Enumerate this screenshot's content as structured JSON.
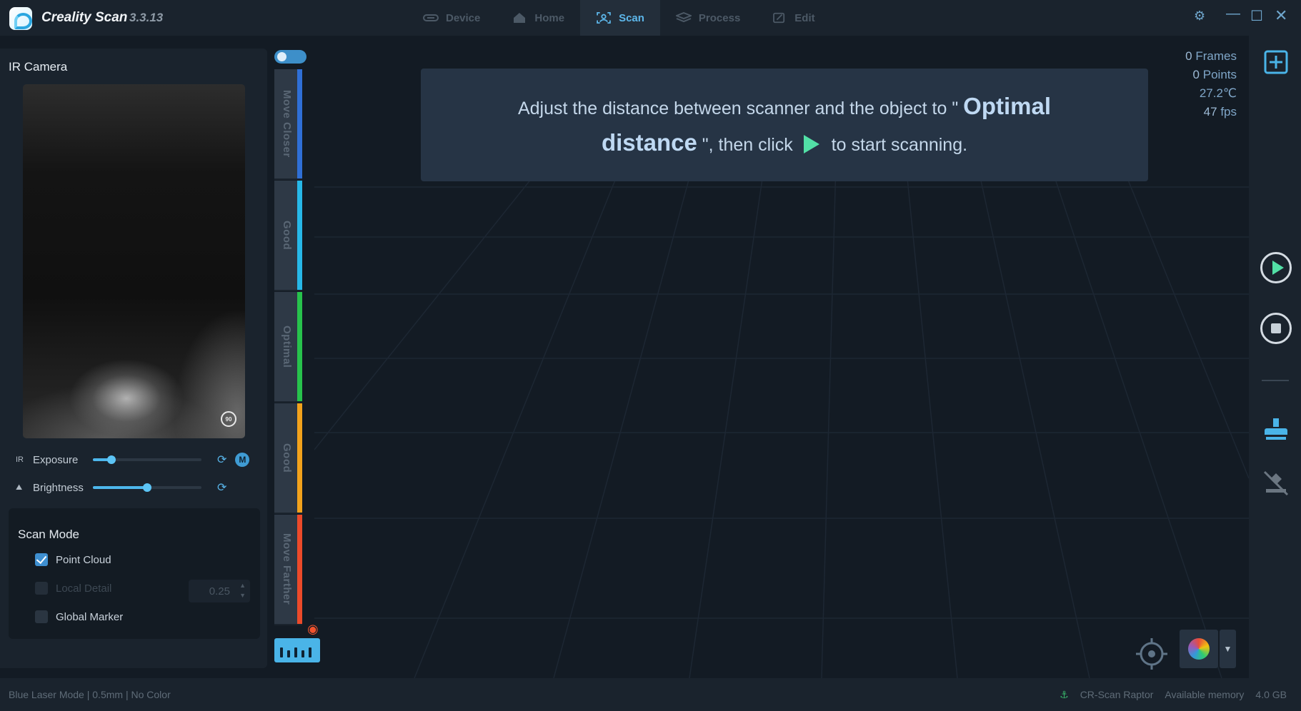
{
  "app": {
    "name": "Creality Scan",
    "version": "3.3.13"
  },
  "nav_tabs": [
    {
      "label": "Device",
      "icon": "device-icon",
      "active": false
    },
    {
      "label": "Home",
      "icon": "home-icon",
      "active": false
    },
    {
      "label": "Scan",
      "icon": "scan-icon",
      "active": true
    },
    {
      "label": "Process",
      "icon": "process-icon",
      "active": false
    },
    {
      "label": "Edit",
      "icon": "edit-icon",
      "active": false
    }
  ],
  "window_controls": [
    "gear-icon",
    "minimize-icon",
    "maximize-icon",
    "close-icon"
  ],
  "left_panel": {
    "ir_camera_title": "IR Camera",
    "exposure": {
      "prefix": "IR",
      "label": "Exposure",
      "value": 0.17,
      "mode_badge": "M"
    },
    "brightness": {
      "label": "Brightness",
      "value": 0.5
    },
    "scan_mode": {
      "title": "Scan Mode",
      "point_cloud": {
        "label": "Point Cloud",
        "checked": true
      },
      "local_detail": {
        "label": "Local Detail",
        "checked": false,
        "disabled": true,
        "value": "0.25"
      },
      "global_marker": {
        "label": "Global Marker",
        "checked": false
      }
    }
  },
  "distance_bar": {
    "segments": [
      {
        "label": "Move Closer",
        "color": "#2f6fd6"
      },
      {
        "label": "Good",
        "color": "#27b8e8"
      },
      {
        "label": "Optimal",
        "color": "#27c24c"
      },
      {
        "label": "Good",
        "color": "#f2a21c"
      },
      {
        "label": "Move Farther",
        "color": "#ec4a2a"
      }
    ]
  },
  "hint": {
    "part1": "Adjust the distance between scanner and the object to \"",
    "optimal": "Optimal",
    "distance": "distance",
    "part2": "\", then click",
    "part3": "to start scanning."
  },
  "stats": {
    "frames_value": "0",
    "frames_label": "Frames",
    "points_value": "0",
    "points_label": "Points",
    "temperature": "27.2",
    "temperature_unit": "℃",
    "fps_value": "47",
    "fps_label": "fps"
  },
  "status_bar": {
    "mode": "Blue Laser Mode",
    "resolution": "0.5mm",
    "color": "No Color",
    "device": "CR-Scan Raptor",
    "memory_label": "Available memory",
    "memory_value": "4.0 GB"
  },
  "colors": {
    "accent": "#4db7ec",
    "play": "#52e0a6",
    "background": "#131b24"
  }
}
